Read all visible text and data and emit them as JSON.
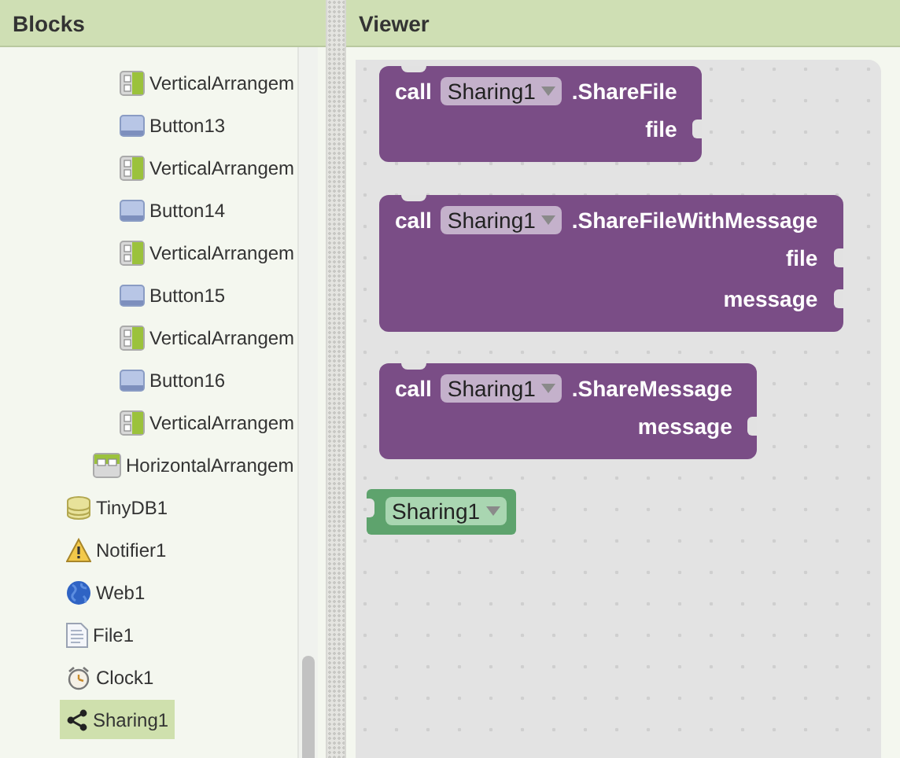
{
  "blocks_panel": {
    "title": "Blocks",
    "tree": [
      {
        "children": [
          {
            "children": [
              {
                "label": "VerticalArrangem",
                "kind": "vertical-arrangement",
                "selected": false
              },
              {
                "label": "Button13",
                "kind": "button",
                "selected": false
              },
              {
                "label": "VerticalArrangem",
                "kind": "vertical-arrangement",
                "selected": false
              },
              {
                "label": "Button14",
                "kind": "button",
                "selected": false
              },
              {
                "label": "VerticalArrangem",
                "kind": "vertical-arrangement",
                "selected": false
              },
              {
                "label": "Button15",
                "kind": "button",
                "selected": false
              },
              {
                "label": "VerticalArrangem",
                "kind": "vertical-arrangement",
                "selected": false
              },
              {
                "label": "Button16",
                "kind": "button",
                "selected": false
              },
              {
                "label": "VerticalArrangem",
                "kind": "vertical-arrangement",
                "selected": false
              }
            ]
          },
          {
            "label": "HorizontalArrangem",
            "kind": "horizontal-arrangement",
            "selected": false
          }
        ]
      },
      {
        "label": "TinyDB1",
        "kind": "database",
        "selected": false
      },
      {
        "label": "Notifier1",
        "kind": "warning",
        "selected": false
      },
      {
        "label": "Web1",
        "kind": "globe",
        "selected": false
      },
      {
        "label": "File1",
        "kind": "file",
        "selected": false
      },
      {
        "label": "Clock1",
        "kind": "clock",
        "selected": false
      },
      {
        "label": "Sharing1",
        "kind": "share",
        "selected": true
      }
    ]
  },
  "viewer": {
    "title": "Viewer",
    "blocks": [
      {
        "kind": "call",
        "keyword": "call",
        "component": "Sharing1",
        "method": ".ShareFile",
        "params": [
          "file"
        ]
      },
      {
        "kind": "call",
        "keyword": "call",
        "component": "Sharing1",
        "method": ".ShareFileWithMessage",
        "params": [
          "file",
          "message"
        ]
      },
      {
        "kind": "call",
        "keyword": "call",
        "component": "Sharing1",
        "method": ".ShareMessage",
        "params": [
          "message"
        ]
      },
      {
        "kind": "component",
        "component": "Sharing1"
      }
    ]
  }
}
